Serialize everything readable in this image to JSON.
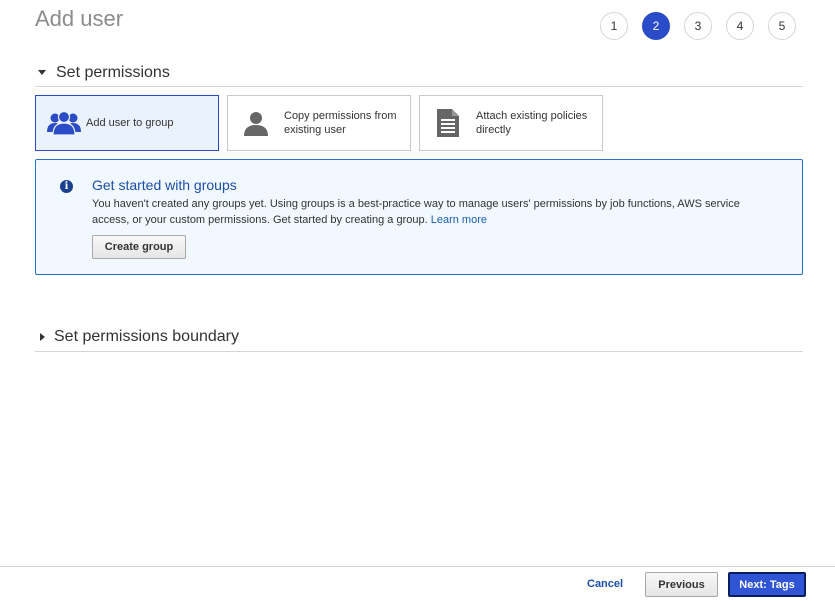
{
  "header": {
    "title": "Add user"
  },
  "wizard": {
    "steps": [
      "1",
      "2",
      "3",
      "4",
      "5"
    ],
    "active_step": "2"
  },
  "permissions_section": {
    "label": "Set permissions"
  },
  "permission_options": [
    {
      "label": "Add user to group",
      "icon": "users-group-icon",
      "selected": true
    },
    {
      "label": "Copy permissions from existing user",
      "icon": "user-icon",
      "selected": false
    },
    {
      "label": "Attach existing policies directly",
      "icon": "document-icon",
      "selected": false
    }
  ],
  "info_box": {
    "title": "Get started with groups",
    "body": "You haven't created any groups yet. Using groups is a best-practice way to manage users' permissions by job functions, AWS service access, or your custom permissions. Get started by creating a group.",
    "link": "Learn more",
    "button": "Create group"
  },
  "boundary_section": {
    "label": "Set permissions boundary"
  },
  "footer": {
    "cancel": "Cancel",
    "previous": "Previous",
    "next": "Next: Tags"
  },
  "colors": {
    "accent": "#2a4cc8",
    "info_border": "#2a6fca",
    "info_bg": "#f1f8ff",
    "link": "#1a4fa8"
  }
}
